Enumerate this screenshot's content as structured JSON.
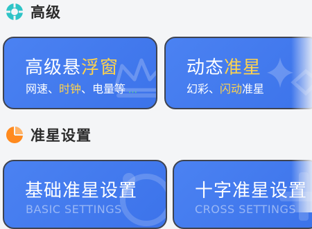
{
  "sections": {
    "advanced": {
      "title": "高级",
      "icon": "lifebuoy-icon",
      "icon_color": "#2ec4c7"
    },
    "crosshair_settings": {
      "title": "准星设置",
      "icon": "pie-chart-icon",
      "icon_color": "#ff8a1f"
    }
  },
  "cards": {
    "floating_window": {
      "title_part1": "高级悬",
      "title_part2": "浮窗",
      "sub_part1": "网速、",
      "sub_part2": "时钟",
      "sub_part3": "、电量等",
      "sub_part4": "…"
    },
    "dynamic_crosshair": {
      "title_part1": "动态",
      "title_part2": "准星",
      "sub_part1": "幻彩、",
      "sub_part2": "闪动",
      "sub_part3": "准星"
    },
    "basic_settings": {
      "title": "基础准星设置",
      "subtitle_en": "BASIC SETTINGS"
    },
    "cross_settings": {
      "title": "十字准星设置",
      "subtitle_en": "CROSS SETTINGS"
    }
  },
  "colors": {
    "card_bg": "#4b82f2",
    "card_border": "#3e4350",
    "highlight": "#ffd34d",
    "page_bg": "#f4f5f7"
  }
}
